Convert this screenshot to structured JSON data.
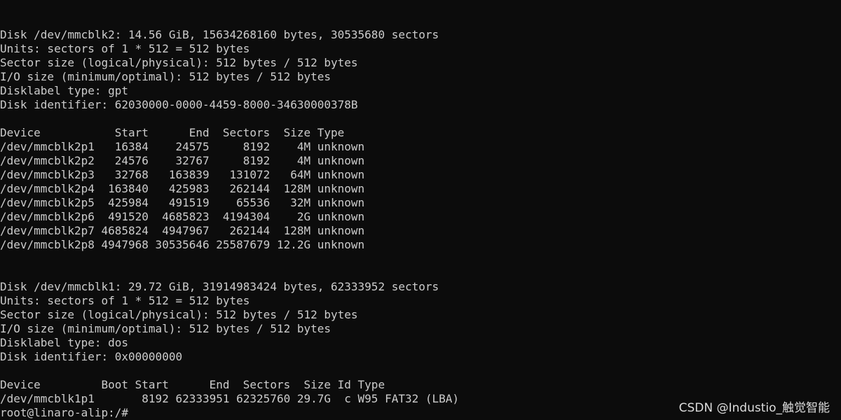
{
  "terminal": {
    "lines": [
      "Disk /dev/mmcblk2: 14.56 GiB, 15634268160 bytes, 30535680 sectors",
      "Units: sectors of 1 * 512 = 512 bytes",
      "Sector size (logical/physical): 512 bytes / 512 bytes",
      "I/O size (minimum/optimal): 512 bytes / 512 bytes",
      "Disklabel type: gpt",
      "Disk identifier: 62030000-0000-4459-8000-34630000378B",
      "",
      "Device           Start      End  Sectors  Size Type",
      "/dev/mmcblk2p1   16384    24575     8192    4M unknown",
      "/dev/mmcblk2p2   24576    32767     8192    4M unknown",
      "/dev/mmcblk2p3   32768   163839   131072   64M unknown",
      "/dev/mmcblk2p4  163840   425983   262144  128M unknown",
      "/dev/mmcblk2p5  425984   491519    65536   32M unknown",
      "/dev/mmcblk2p6  491520  4685823  4194304    2G unknown",
      "/dev/mmcblk2p7 4685824  4947967   262144  128M unknown",
      "/dev/mmcblk2p8 4947968 30535646 25587679 12.2G unknown",
      "",
      "",
      "Disk /dev/mmcblk1: 29.72 GiB, 31914983424 bytes, 62333952 sectors",
      "Units: sectors of 1 * 512 = 512 bytes",
      "Sector size (logical/physical): 512 bytes / 512 bytes",
      "I/O size (minimum/optimal): 512 bytes / 512 bytes",
      "Disklabel type: dos",
      "Disk identifier: 0x00000000",
      "",
      "Device         Boot Start      End  Sectors  Size Id Type",
      "/dev/mmcblk1p1       8192 62333951 62325760 29.7G  c W95 FAT32 (LBA)"
    ],
    "prompt": "root@linaro-alip:/#"
  },
  "watermark": "CSDN @Industio_触觉智能",
  "colors": {
    "background": "#0c0c0c",
    "text": "#cccccc"
  }
}
